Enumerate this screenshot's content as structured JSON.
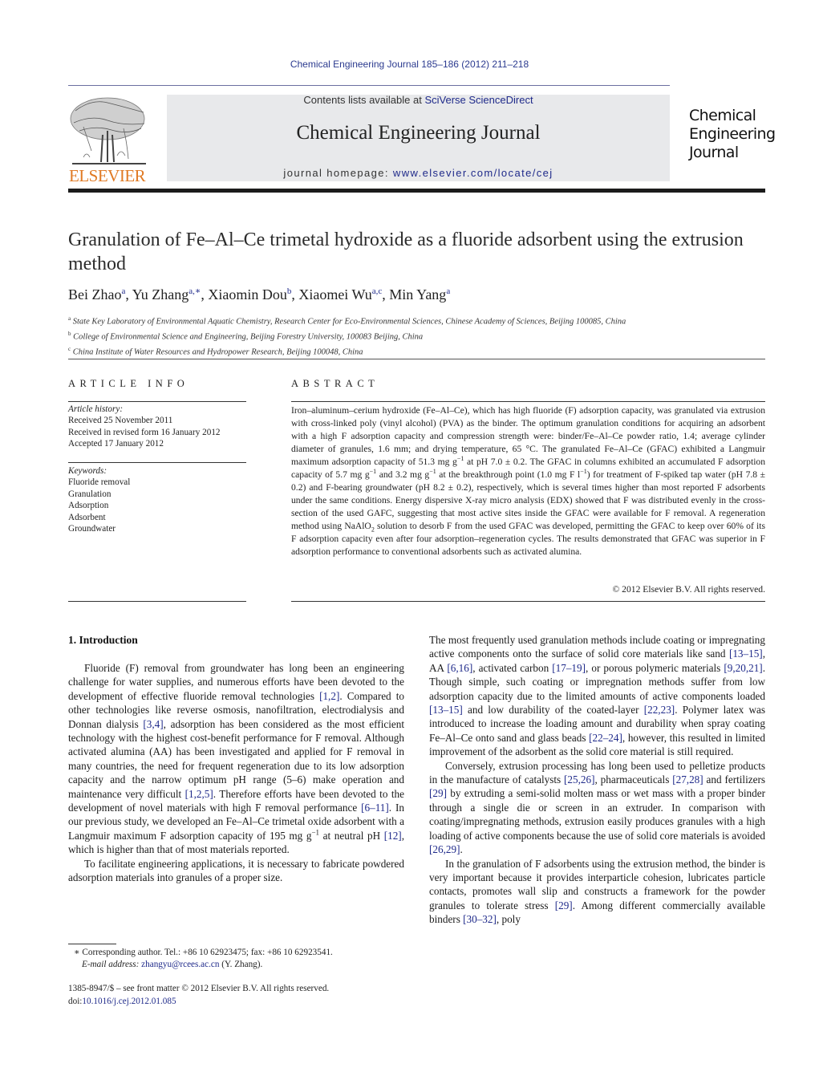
{
  "header": {
    "journal_reference": "Chemical Engineering Journal 185–186 (2012) 211–218",
    "contents_prefix": "Contents lists available at ",
    "contents_link": "SciVerse ScienceDirect",
    "journal_title": "Chemical Engineering Journal",
    "homepage_prefix": "journal homepage: ",
    "homepage_link": "www.elsevier.com/locate/cej",
    "publisher_wordmark": "ELSEVIER",
    "journal_logo_lines": [
      "Chemical",
      "Engineering",
      "Journal"
    ],
    "colors": {
      "publisher_orange": "#e07a24",
      "link_blue": "#1f2a8a",
      "banner_gray": "#e8e9eb"
    }
  },
  "article": {
    "title": "Granulation of Fe–Al–Ce trimetal hydroxide as a fluoride adsorbent using the extrusion method",
    "authors": [
      {
        "name": "Bei Zhao",
        "aff": "a"
      },
      {
        "name": "Yu Zhang",
        "aff": "a,∗"
      },
      {
        "name": "Xiaomin Dou",
        "aff": "b"
      },
      {
        "name": "Xiaomei Wu",
        "aff": "a,c"
      },
      {
        "name": "Min Yang",
        "aff": "a"
      }
    ],
    "affiliations": [
      {
        "mark": "a",
        "text": "State Key Laboratory of Environmental Aquatic Chemistry, Research Center for Eco-Environmental Sciences, Chinese Academy of Sciences, Beijing 100085, China"
      },
      {
        "mark": "b",
        "text": "College of Environmental Science and Engineering, Beijing Forestry University, 100083 Beijing, China"
      },
      {
        "mark": "c",
        "text": "China Institute of Water Resources and Hydropower Research, Beijing 100048, China"
      }
    ]
  },
  "article_info": {
    "heading": "ARTICLE INFO",
    "history_label": "Article history:",
    "history": [
      "Received 25 November 2011",
      "Received in revised form 16 January 2012",
      "Accepted 17 January 2012"
    ],
    "keywords_label": "Keywords:",
    "keywords": [
      "Fluoride removal",
      "Granulation",
      "Adsorption",
      "Adsorbent",
      "Groundwater"
    ]
  },
  "abstract": {
    "heading": "ABSTRACT",
    "p1": "Iron–aluminum–cerium hydroxide (Fe–Al–Ce), which has high fluoride (F) adsorption capacity, was granulated via extrusion with cross-linked poly (vinyl alcohol) (PVA) as the binder. The optimum granulation conditions for acquiring an adsorbent with a high F adsorption capacity and compression strength were: binder/Fe–Al–Ce powder ratio, 1.4; average cylinder diameter of granules, 1.6 mm; and drying temperature, 65 °C. The granulated Fe–Al–Ce (GFAC) exhibited a Langmuir maximum adsorption capacity of 51.3 mg g",
    "p2": " at pH 7.0 ± 0.2. The GFAC in columns exhibited an accumulated F adsorption capacity of 5.7 mg g",
    "p3": " and 3.2 mg g",
    "p4": " at the breakthrough point (1.0 mg F l",
    "p5": ") for treatment of F-spiked tap water (pH 7.8 ± 0.2) and F-bearing groundwater (pH 8.2 ± 0.2), respectively, which is several times higher than most reported F adsorbents under the same conditions. Energy dispersive X-ray micro analysis (EDX) showed that F was distributed evenly in the cross-section of the used GAFC, suggesting that most active sites inside the GFAC were available for F removal. A regeneration method using NaAlO",
    "p6": " solution to desorb F from the used GFAC was developed, permitting the GFAC to keep over 60% of its F adsorption capacity even after four adsorption–regeneration cycles. The results demonstrated that GFAC was superior in F adsorption performance to conventional adsorbents such as activated alumina.",
    "sup_minus_one": "−1",
    "sub_two": "2",
    "copyright": "© 2012 Elsevier B.V. All rights reserved."
  },
  "introduction": {
    "heading": "1.  Introduction",
    "left": {
      "a1": "Fluoride (F) removal from groundwater has long been an engineering challenge for water supplies, and numerous efforts have been devoted to the development of effective fluoride removal technologies ",
      "c1": "[1,2]",
      "a2": ". Compared to other technologies like reverse osmosis, nanofiltration, electrodialysis and Donnan dialysis ",
      "c2": "[3,4]",
      "a3": ", adsorption has been considered as the most efficient technology with the highest cost-benefit performance for F removal. Although activated alumina (AA) has been investigated and applied for F removal in many countries, the need for frequent regeneration due to its low adsorption capacity and the narrow optimum pH range (5–6) make operation and maintenance very difficult ",
      "c3": "[1,2,5]",
      "a4": ". Therefore efforts have been devoted to the development of novel materials with high F removal performance ",
      "c4": "[6–11]",
      "a5": ". In our previous study, we developed an Fe–Al–Ce trimetal oxide adsorbent with a Langmuir maximum F adsorption capacity of 195 mg g",
      "sup": "−1",
      "a6": " at neutral pH ",
      "c5": "[12]",
      "a7": ", which is higher than that of most materials reported.",
      "p2": "To facilitate engineering applications, it is necessary to fabricate powdered adsorption materials into granules of a proper size."
    },
    "right": {
      "p1": [
        "The most frequently used granulation methods include coating or impregnating active components onto the surface of solid core materials like sand ",
        "[13–15]",
        ", AA ",
        "[6,16]",
        ", activated carbon ",
        "[17–19]",
        ", or porous polymeric materials ",
        "[9,20,21]",
        ". Though simple, such coating or impregnation methods suffer from low adsorption capacity due to the limited amounts of active components loaded ",
        "[13–15]",
        " and low durability of the coated-layer ",
        "[22,23]",
        ". Polymer latex was introduced to increase the loading amount and durability when spray coating Fe–Al–Ce onto sand and glass beads ",
        "[22–24]",
        ", however, this resulted in limited improvement of the adsorbent as the solid core material is still required."
      ],
      "p2": [
        "Conversely, extrusion processing has long been used to pelletize products in the manufacture of catalysts ",
        "[25,26]",
        ", pharmaceuticals ",
        "[27,28]",
        " and fertilizers ",
        "[29]",
        " by extruding a semi-solid molten mass or wet mass with a proper binder through a single die or screen in an extruder. In comparison with coating/impregnating methods, extrusion easily produces granules with a high loading of active components because the use of solid core materials is avoided ",
        "[26,29]",
        "."
      ],
      "p3": [
        "In the granulation of F adsorbents using the extrusion method, the binder is very important because it provides interparticle cohesion, lubricates particle contacts, promotes wall slip and constructs a framework for the powder granules to tolerate stress ",
        "[29]",
        ". Among different commercially available binders ",
        "[30–32]",
        ", poly"
      ]
    }
  },
  "footnote": {
    "mark": "∗",
    "text": "Corresponding author. Tel.: +86 10 62923475; fax: +86 10 62923541.",
    "email_label": "E-mail address: ",
    "email": "zhangyu@rcees.ac.cn",
    "email_suffix": " (Y. Zhang)."
  },
  "front_matter": {
    "issn_line": "1385-8947/$ – see front matter © 2012 Elsevier B.V. All rights reserved.",
    "doi_prefix": "doi:",
    "doi": "10.1016/j.cej.2012.01.085"
  }
}
